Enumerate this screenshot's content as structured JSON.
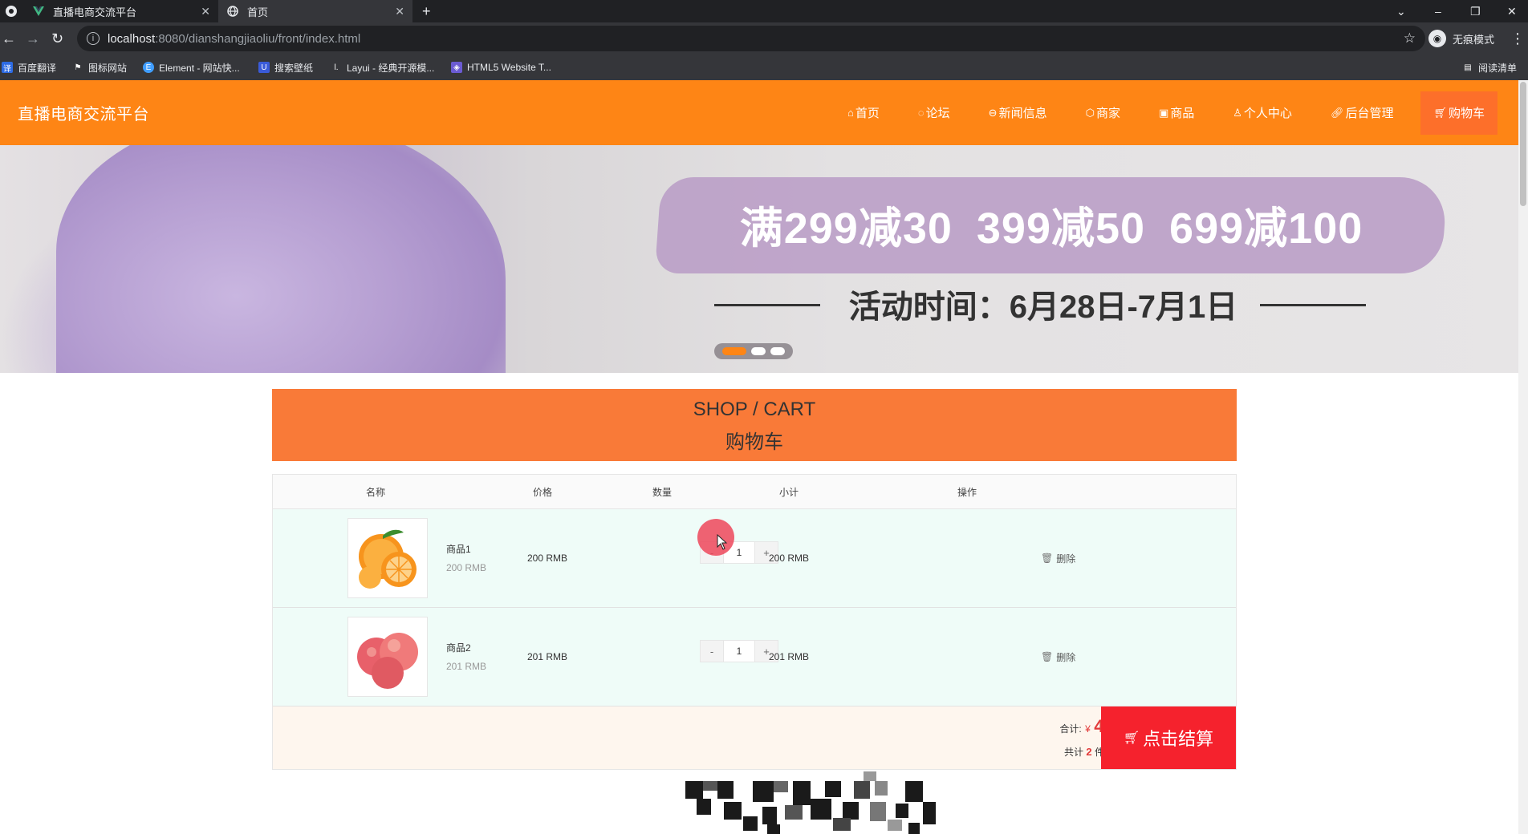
{
  "browser": {
    "tabs": [
      {
        "title": "直播电商交流平台",
        "icon": "vue-logo-icon"
      },
      {
        "title": "首页",
        "icon": "globe-icon"
      }
    ],
    "url_host": "localhost",
    "url_path": ":8080/dianshangjiaoliu/front/index.html",
    "profile_label": "无痕模式",
    "bookmarks": [
      "百度翻译",
      "图标网站",
      "Element - 网站快...",
      "搜索壁纸",
      "Layui - 经典开源模...",
      "HTML5 Website T..."
    ],
    "reading_list": "阅读清单"
  },
  "site": {
    "brand": "直播电商交流平台",
    "menu": [
      "首页",
      "论坛",
      "新闻信息",
      "商家",
      "商品",
      "个人中心",
      "后台管理",
      "购物车"
    ],
    "accent": "#fe8515"
  },
  "banner": {
    "promo": "满299减30  399减50  699减100",
    "period": "活动时间：6月28日-7月1日",
    "slides": 3,
    "active_slide": 1
  },
  "cart": {
    "title_en": "SHOP / CART",
    "title_cn": "购物车",
    "columns": [
      "名称",
      "价格",
      "数量",
      "小计",
      "操作"
    ],
    "items": [
      {
        "name": "商品1",
        "unit": "200 RMB",
        "price": "200 RMB",
        "qty": "1",
        "subtotal": "200 RMB",
        "action": "删除"
      },
      {
        "name": "商品2",
        "unit": "201 RMB",
        "price": "201 RMB",
        "qty": "1",
        "subtotal": "201 RMB",
        "action": "删除"
      }
    ],
    "stepper_minus": "-",
    "stepper_plus": "+",
    "total_label": "合计:",
    "currency": "¥",
    "total": "401",
    "count_prefix": "共计",
    "count": "2",
    "count_suffix": "件商品",
    "checkout": "点击结算",
    "checkout_color": "#f5222d"
  }
}
